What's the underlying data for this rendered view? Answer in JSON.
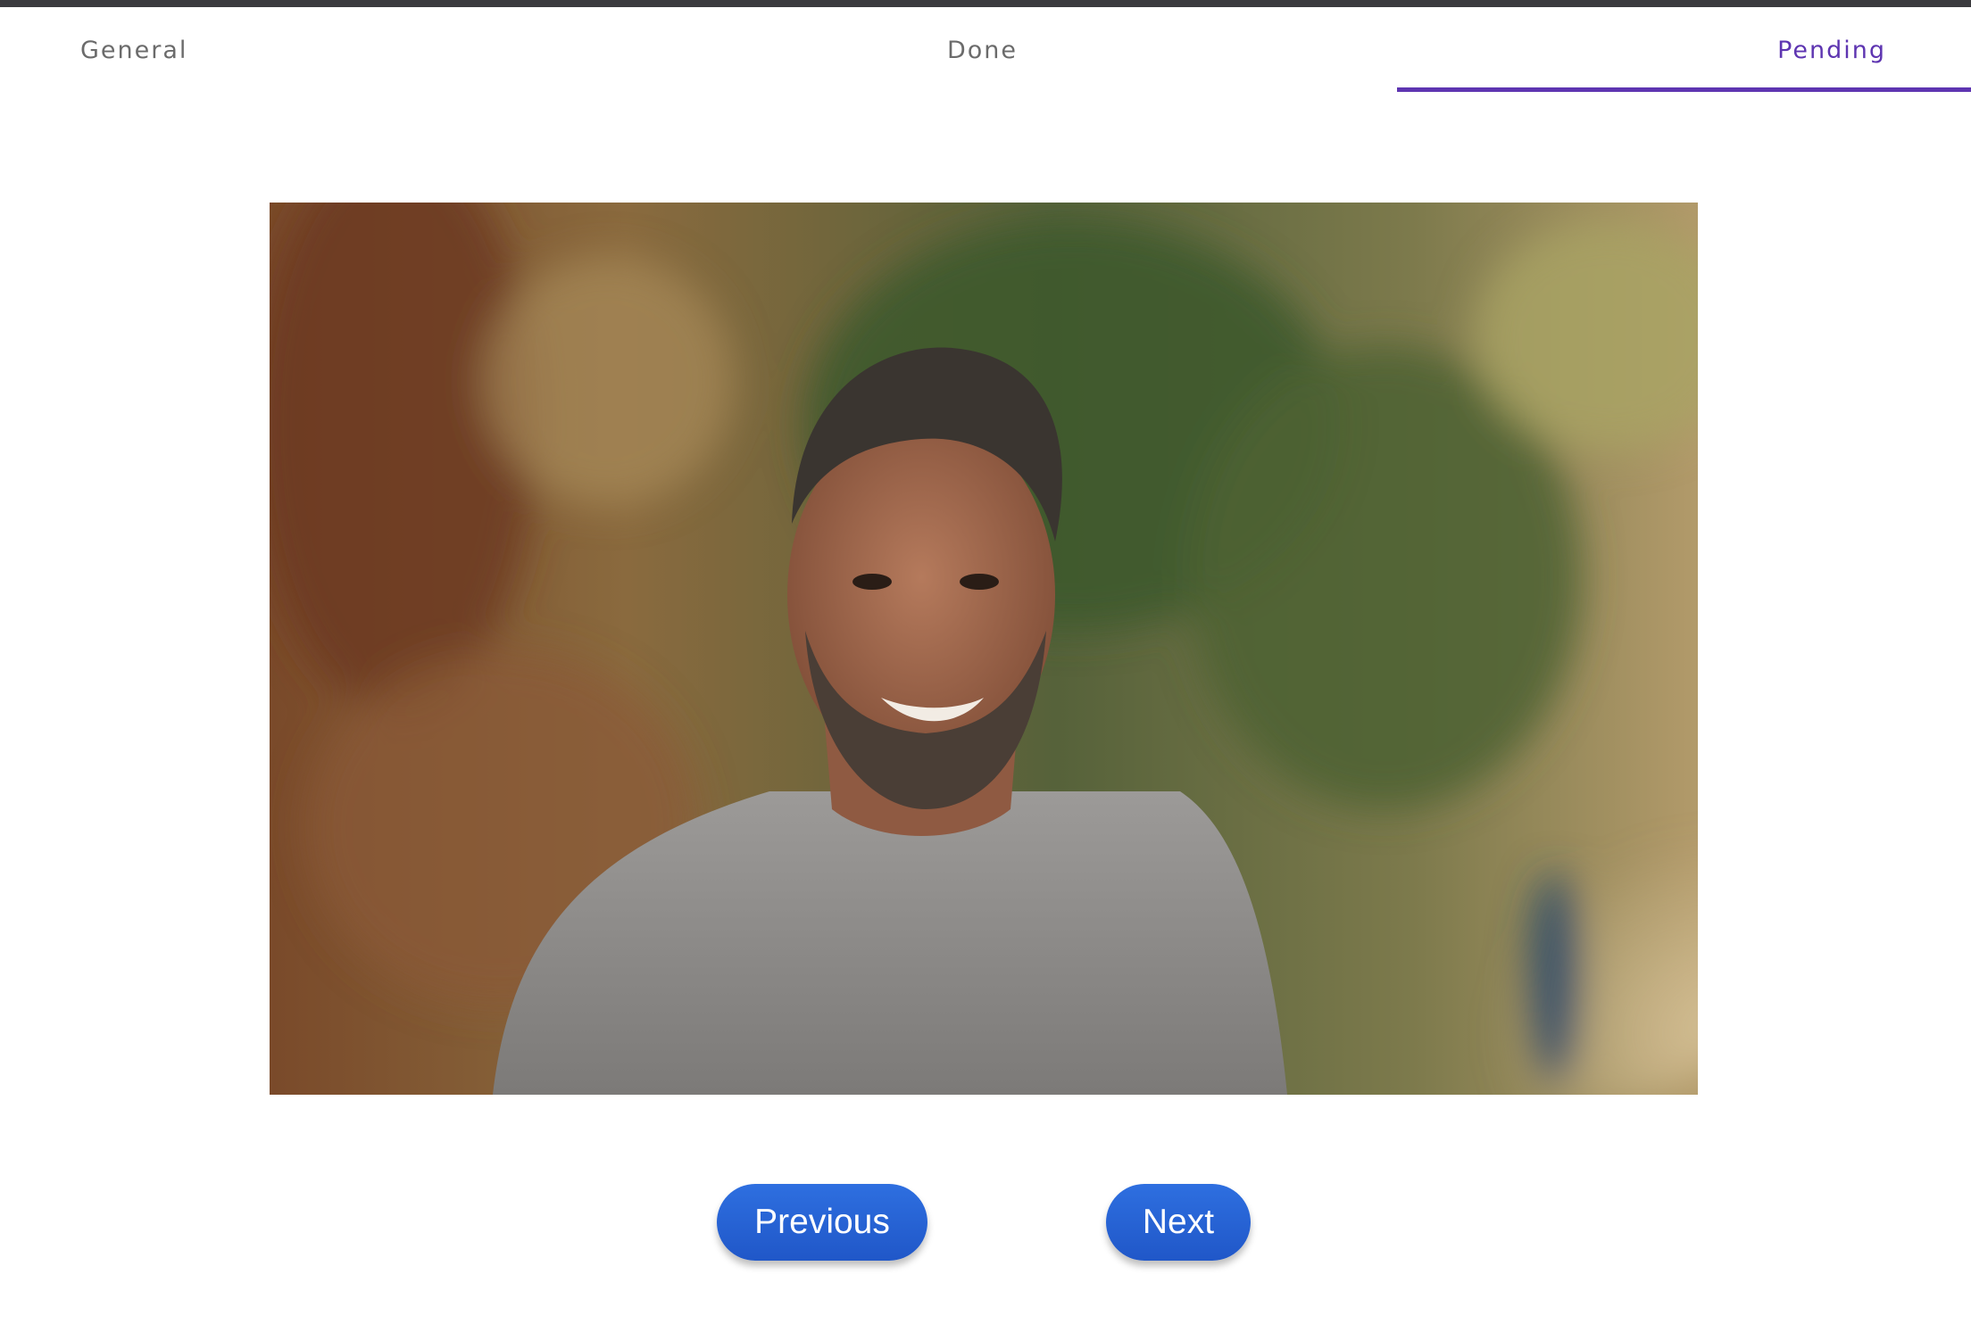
{
  "tabs": [
    {
      "label": "General",
      "active": false
    },
    {
      "label": "Done",
      "active": false
    },
    {
      "label": "Pending",
      "active": true
    }
  ],
  "image": {
    "subject": "smiling man in grey sweatshirt outdoors",
    "icon": "portrait-photo"
  },
  "buttons": {
    "previous": "Previous",
    "next": "Next"
  },
  "colors": {
    "accent": "#5e35b1",
    "button": "#2563d6",
    "tab_text": "#6b6b6b",
    "top_bar": "#3a3a3e"
  }
}
